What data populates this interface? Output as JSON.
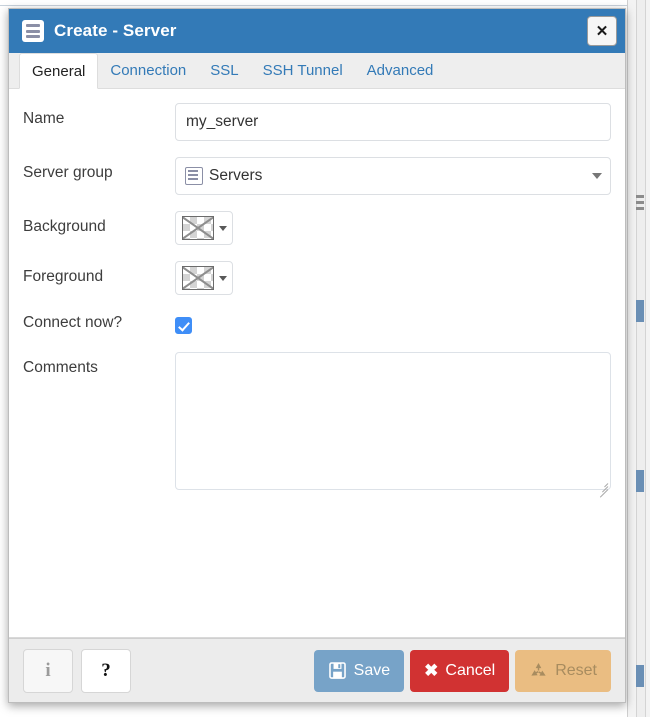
{
  "window": {
    "title": "Create - Server",
    "icon": "server-icon",
    "close_label": "✕",
    "accent_color": "#337ab7"
  },
  "tabs": [
    {
      "label": "General",
      "active": true
    },
    {
      "label": "Connection",
      "active": false
    },
    {
      "label": "SSL",
      "active": false
    },
    {
      "label": "SSH Tunnel",
      "active": false
    },
    {
      "label": "Advanced",
      "active": false
    }
  ],
  "form": {
    "name": {
      "label": "Name",
      "value": "my_server",
      "placeholder": ""
    },
    "server_group": {
      "label": "Server group",
      "value": "Servers",
      "icon": "server-group-icon"
    },
    "background": {
      "label": "Background",
      "value": "",
      "swatch": "transparent-none"
    },
    "foreground": {
      "label": "Foreground",
      "value": "",
      "swatch": "transparent-none"
    },
    "connect_now": {
      "label": "Connect now?",
      "checked": true,
      "check_color": "#3f8ef7"
    },
    "comments": {
      "label": "Comments",
      "value": "",
      "placeholder": ""
    }
  },
  "footer": {
    "info_label": "i",
    "help_label": "?",
    "save_label": "Save",
    "cancel_label": "Cancel",
    "reset_label": "Reset",
    "save_color": "#77a3c8",
    "cancel_color": "#d13232",
    "reset_color": "#eabd82"
  }
}
